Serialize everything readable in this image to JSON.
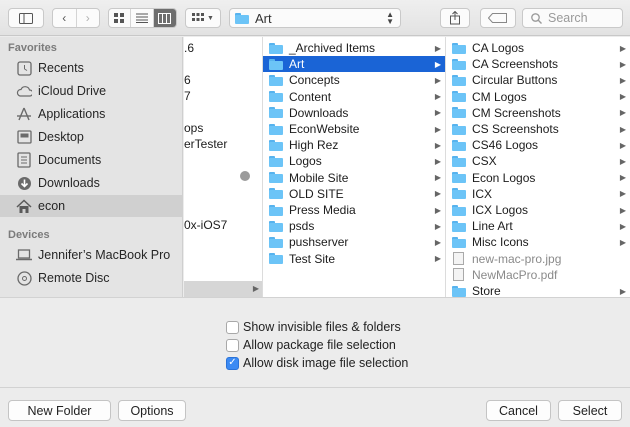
{
  "toolbar": {
    "path": "Art",
    "search_placeholder": "Search"
  },
  "sidebar": {
    "favorites_heading": "Favorites",
    "favorites": [
      {
        "label": "Recents",
        "icon": "clock-icon"
      },
      {
        "label": "iCloud Drive",
        "icon": "cloud-icon"
      },
      {
        "label": "Applications",
        "icon": "applications-icon"
      },
      {
        "label": "Desktop",
        "icon": "desktop-icon"
      },
      {
        "label": "Documents",
        "icon": "documents-icon"
      },
      {
        "label": "Downloads",
        "icon": "downloads-icon"
      },
      {
        "label": "econ",
        "icon": "home-icon",
        "selected": true
      }
    ],
    "devices_heading": "Devices",
    "devices": [
      {
        "label": "Jennifer’s MacBook Pro",
        "icon": "laptop-icon"
      },
      {
        "label": "Remote Disc",
        "icon": "disc-icon"
      }
    ]
  },
  "column1": {
    "fragments": [
      ".6",
      "6",
      "7",
      "ops",
      "erTester",
      "0x-iOS7"
    ]
  },
  "column2": {
    "items": [
      "_Archived Items",
      "Art",
      "Concepts",
      "Content",
      "Downloads",
      "EconWebsite",
      "High Rez",
      "Logos",
      "Mobile Site",
      "OLD SITE",
      "Press Media",
      "psds",
      "pushserver",
      "Test Site"
    ],
    "selected": "Art"
  },
  "column3": {
    "items": [
      {
        "name": "CA Logos",
        "type": "folder"
      },
      {
        "name": "CA Screenshots",
        "type": "folder"
      },
      {
        "name": "Circular Buttons",
        "type": "folder"
      },
      {
        "name": "CM Logos",
        "type": "folder"
      },
      {
        "name": "CM Screenshots",
        "type": "folder"
      },
      {
        "name": "CS Screenshots",
        "type": "folder"
      },
      {
        "name": "CS46 Logos",
        "type": "folder"
      },
      {
        "name": "CSX",
        "type": "folder"
      },
      {
        "name": "Econ Logos",
        "type": "folder"
      },
      {
        "name": "ICX",
        "type": "folder"
      },
      {
        "name": "ICX Logos",
        "type": "folder"
      },
      {
        "name": "Line Art",
        "type": "folder"
      },
      {
        "name": "Misc Icons",
        "type": "folder"
      },
      {
        "name": "new-mac-pro.jpg",
        "type": "file"
      },
      {
        "name": "NewMacPro.pdf",
        "type": "file"
      },
      {
        "name": "Store",
        "type": "folder"
      }
    ]
  },
  "options": {
    "show_invisible": {
      "label": "Show invisible files & folders",
      "checked": false
    },
    "allow_package": {
      "label": "Allow package file selection",
      "checked": false
    },
    "allow_disk_image": {
      "label": "Allow disk image file selection",
      "checked": true
    }
  },
  "buttons": {
    "new_folder": "New Folder",
    "options": "Options",
    "cancel": "Cancel",
    "select": "Select"
  },
  "colors": {
    "selection": "#1a64d6",
    "folder": "#6cc4f7",
    "checkbox_on": "#3b8af3"
  }
}
